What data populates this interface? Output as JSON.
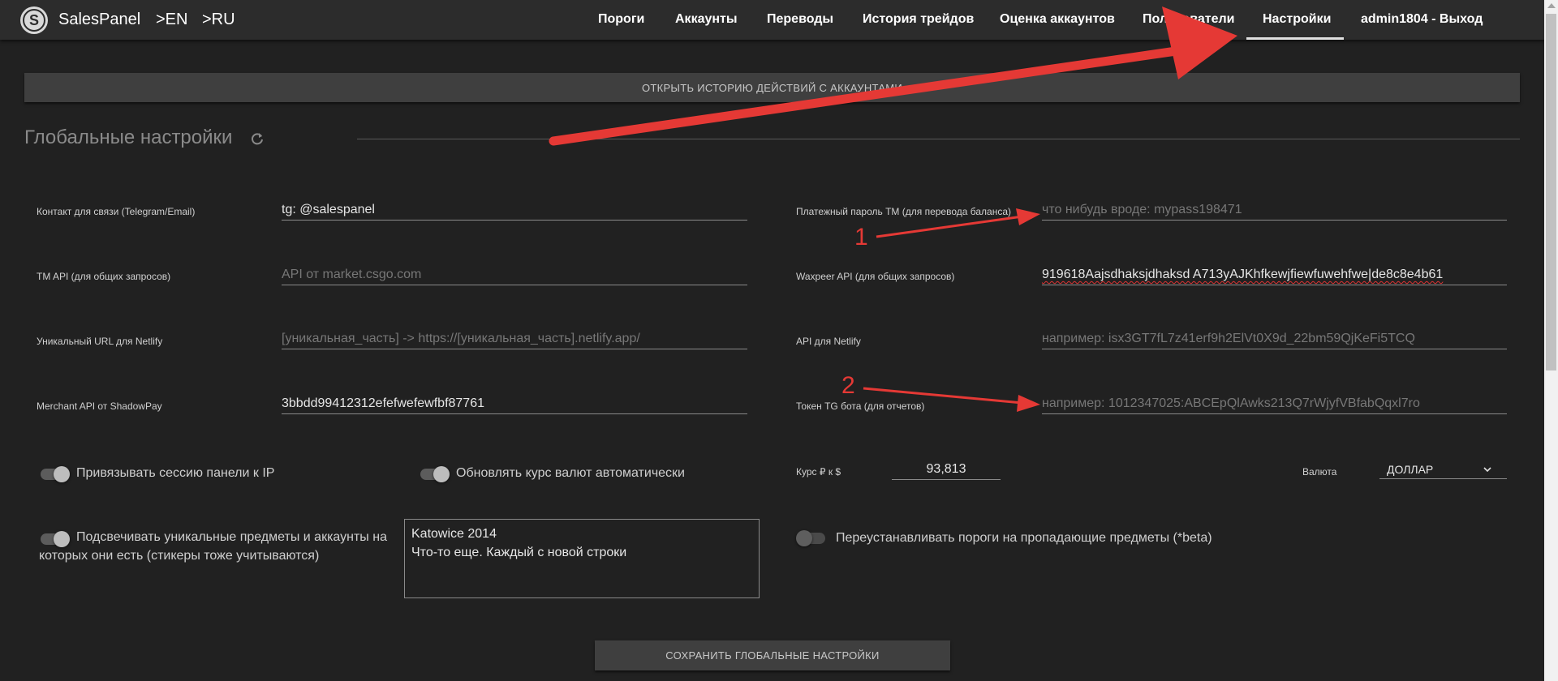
{
  "navbar": {
    "brand": "SalesPanel",
    "lang_en": ">EN",
    "lang_ru": ">RU",
    "items": [
      {
        "label": "Пороги"
      },
      {
        "label": "Аккаунты"
      },
      {
        "label": "Переводы"
      },
      {
        "label": "История трейдов"
      },
      {
        "label": "Оценка аккаунтов"
      },
      {
        "label": "Пользователи"
      },
      {
        "label": "Настройки"
      },
      {
        "label": "admin1804 - Выход"
      }
    ],
    "active": "Настройки"
  },
  "history_button": "ОТКРЫТЬ ИСТОРИЮ ДЕЙСТВИЙ С АККАУНТАМИ",
  "section_title": "Глобальные настройки",
  "fields": {
    "contact": {
      "label": "Контакт для связи (Telegram/Email)",
      "value": "tg: @salespanel"
    },
    "tm_api": {
      "label": "TM API (для общих запросов)",
      "placeholder": "API от market.csgo.com"
    },
    "netlify_url": {
      "label": "Уникальный URL для Netlify",
      "placeholder": "[уникальная_часть] -> https://[уникальная_часть].netlify.app/"
    },
    "merchant_api": {
      "label": "Merchant API от ShadowPay",
      "value": "3bbdd99412312efefwefewfbf87761"
    },
    "tm_password": {
      "label": "Платежный пароль TM (для перевода баланса)",
      "placeholder": "что нибудь вроде: mypass198471"
    },
    "waxpeer_api": {
      "label": "Waxpeer API (для общих запросов)",
      "value": "919618Aajsdhaksjdhaksd A713yAJKhfkewjfiewfuwehfwe|de8c8e4b61"
    },
    "netlify_api": {
      "label": "API для Netlify",
      "placeholder": "например: isx3GT7fL7z41erf9h2ElVt0X9d_22bm59QjKeFi5TCQ"
    },
    "tg_token": {
      "label": "Токен TG бота (для отчетов)",
      "placeholder": "например: 1012347025:ABCEpQlAwks213Q7rWjyfVBfabQqxl7ro"
    }
  },
  "switches": {
    "bind_ip": "Привязывать сессию панели к IP",
    "auto_rate": "Обновлять курс валют автоматически",
    "highlight": "Подсвечивать уникальные предметы и аккаунты на которых они есть (стикеры тоже учитываются)",
    "reset_thresholds": "Переустанавливать пороги на пропадающие предметы (*beta)"
  },
  "rate": {
    "label": "Курс ₽ к $",
    "value": "93,813"
  },
  "currency": {
    "label": "Валюта",
    "value": "ДОЛЛАР"
  },
  "textarea_lines": [
    "Katowice 2014",
    "Что-то еще. Каждый с новой строки"
  ],
  "save_button": "СОХРАНИТЬ ГЛОБАЛЬНЫЕ НАСТРОЙКИ",
  "annotations": {
    "one": "1",
    "two": "2"
  },
  "colors": {
    "arrow": "#e53935",
    "background": "#212121",
    "navbar": "#2c2c2c"
  }
}
